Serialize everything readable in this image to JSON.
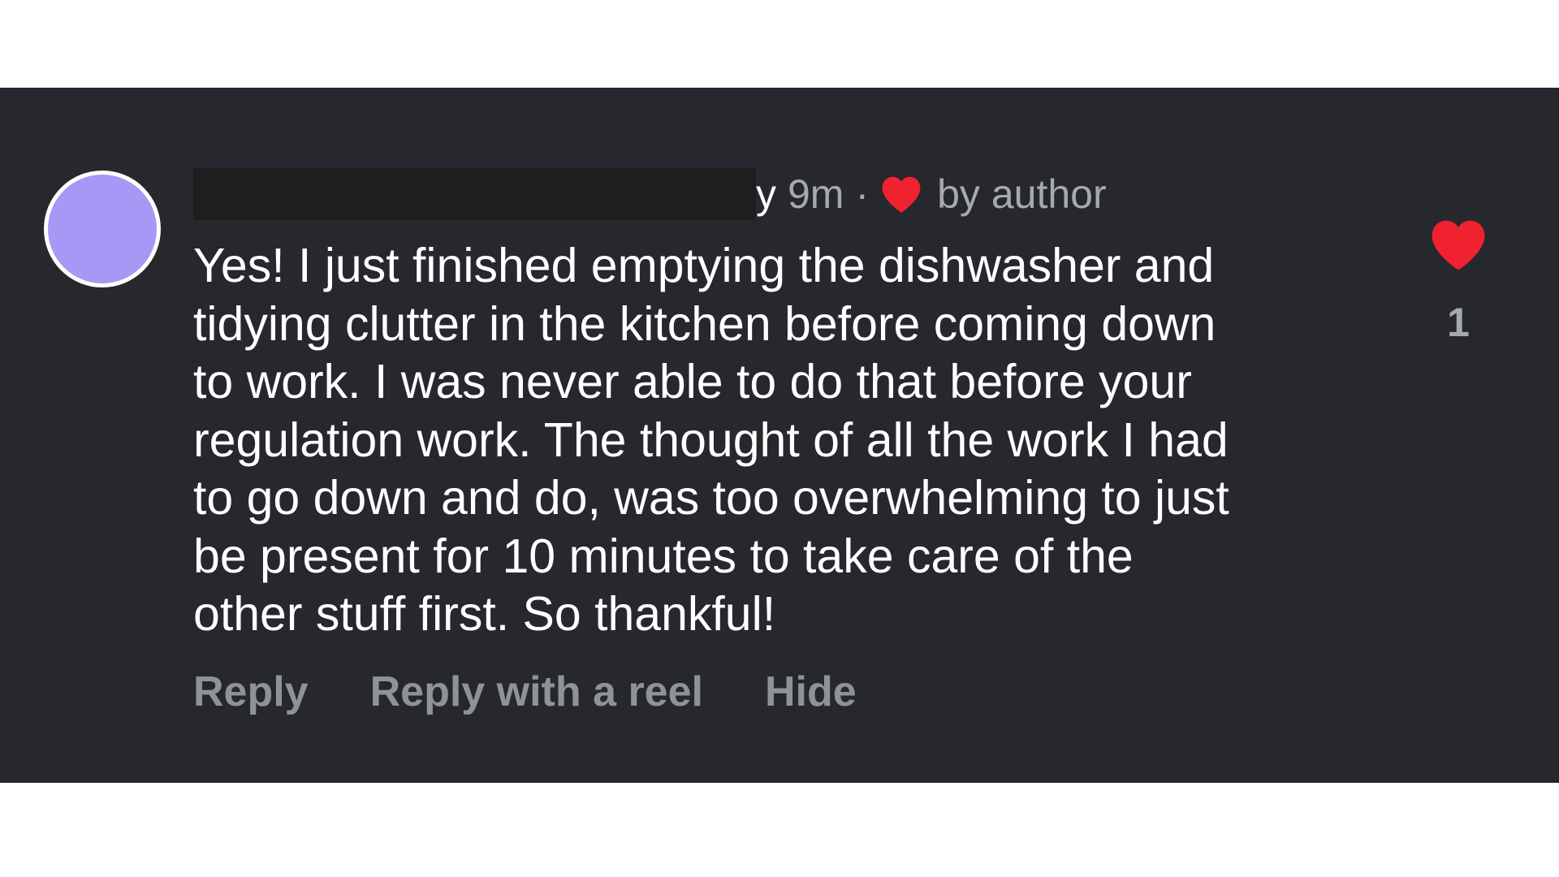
{
  "comment": {
    "author_visible_tail": "y",
    "timestamp": "9m",
    "separator": "·",
    "liked_by_author_label": "by author",
    "text": "Yes! I just finished emptying the dishwasher and\ntidying clutter in the kitchen before coming down\nto work. I was never able to do that before your\nregulation work. The thought of all the work I had\nto go down and do, was too overwhelming to just\nbe present for 10 minutes to take care of the\nother stuff first. So thankful!",
    "like_count": "1"
  },
  "actions": {
    "reply": "Reply",
    "reply_with_reel": "Reply with a reel",
    "hide": "Hide"
  },
  "colors": {
    "background": "#26282d",
    "avatar": "#a599f5",
    "heart": "#f0222f",
    "muted_text": "#a6a9ae",
    "action_text": "#8f9399"
  },
  "icons": {
    "avatar": "avatar",
    "author_like": "heart-icon",
    "like_button": "heart-icon"
  }
}
